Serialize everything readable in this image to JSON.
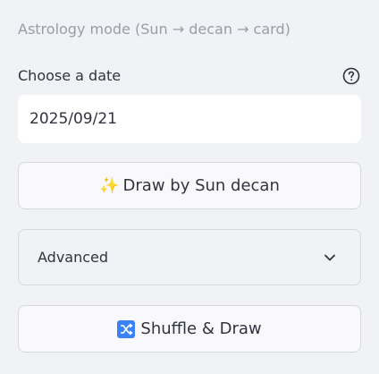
{
  "caption": "Astrology mode (Sun → decan → card)",
  "date_picker": {
    "label": "Choose a date",
    "value": "2025/09/21"
  },
  "buttons": {
    "draw_sun_label": "Draw by Sun decan",
    "draw_sun_emoji": "✨",
    "shuffle_label": "Shuffle & Draw"
  },
  "expander": {
    "label": "Advanced"
  },
  "icons": {
    "help": "question-circle-icon",
    "chevron": "chevron-down-icon",
    "sparkles": "sparkles-icon",
    "shuffle": "shuffle-icon"
  },
  "colors": {
    "background": "#f0f2f6",
    "text": "#31333f",
    "caption": "#9a9ca8",
    "input_bg": "#ffffff",
    "shuffle_badge": "#3b82f6"
  }
}
